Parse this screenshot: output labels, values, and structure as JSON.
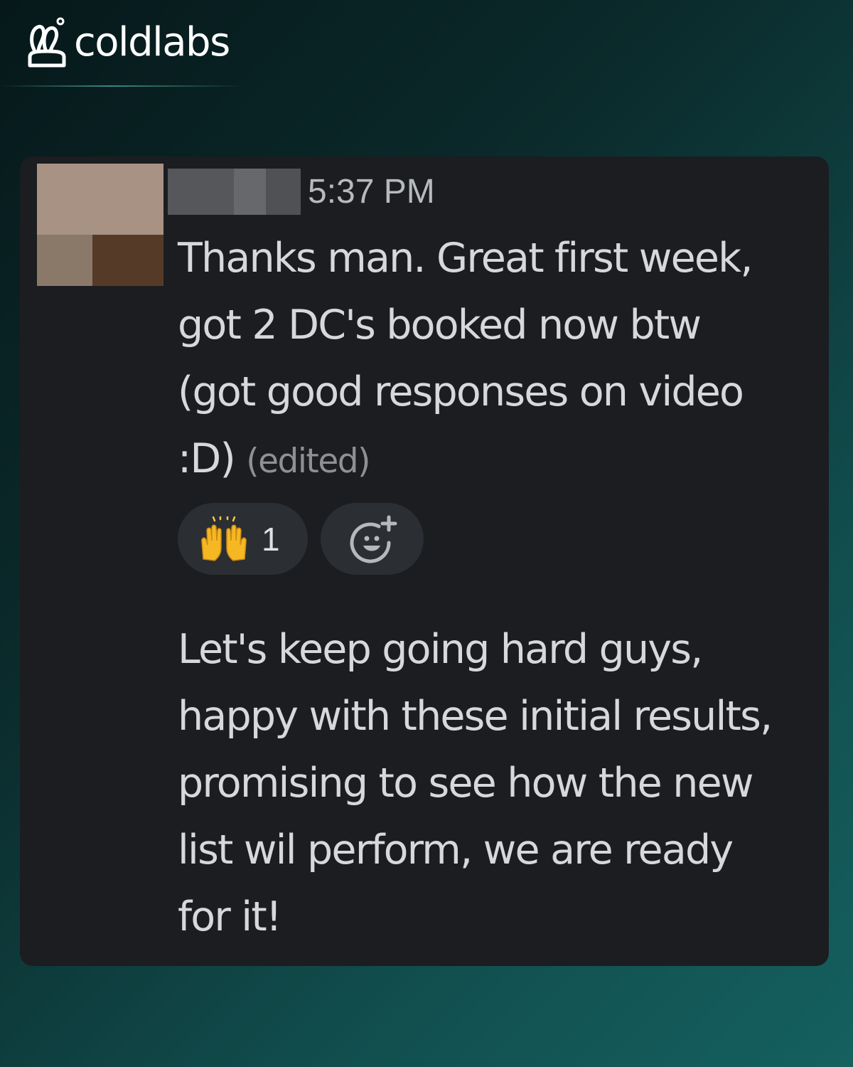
{
  "brand": {
    "name": "coldlabs",
    "logo_icon": "coldlabs-logo-icon"
  },
  "message": {
    "timestamp": "5:37 PM",
    "first_lines": [
      "Thanks man. Great first week,",
      "got 2 DC's booked now btw",
      "(got good responses on video",
      ":D)"
    ],
    "edited_label": "(edited)",
    "reaction": {
      "emoji": "raised-hands-icon",
      "count": "1"
    },
    "add_reaction_icon": "add-emoji-icon",
    "second_lines": [
      "Let's keep going hard guys,",
      "happy with these initial results,",
      "promising to see how the new",
      "list wil perform, we are ready",
      "for it!"
    ]
  },
  "colors": {
    "card_bg": "#1b1d21",
    "message_text": "#d6d8da",
    "timestamp": "#b7babd",
    "reaction_bg": "#2b2e33",
    "emoji_yellow": "#f5b823"
  }
}
